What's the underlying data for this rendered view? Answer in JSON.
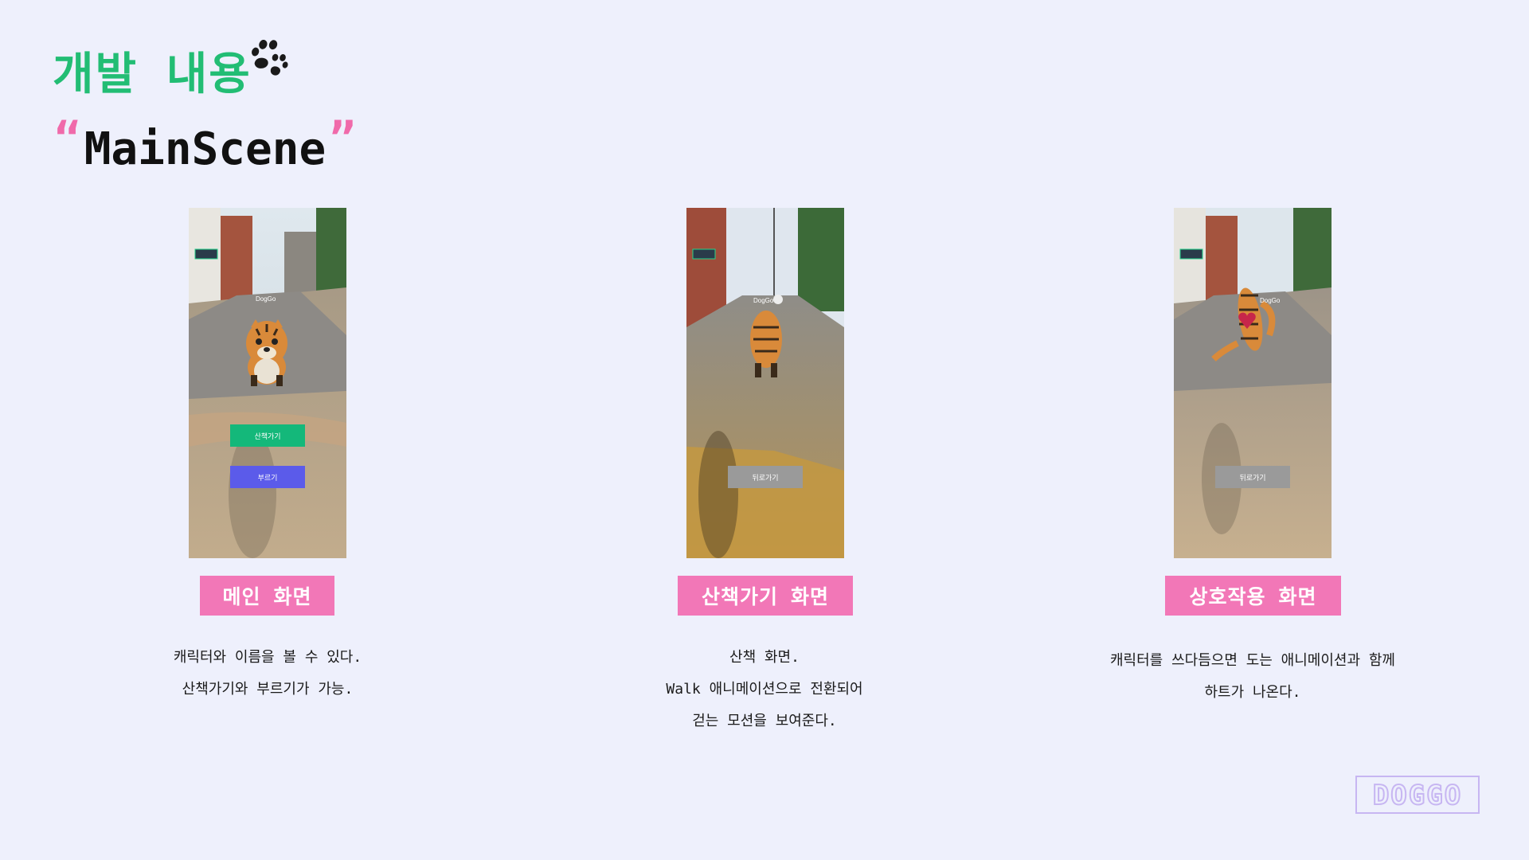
{
  "header": {
    "title": "개발 내용",
    "scene_name": "MainScene",
    "quote_open": "“",
    "quote_close": "”"
  },
  "screens": [
    {
      "caption": "메인 화면",
      "desc_lines": [
        "캐릭터와 이름을 볼 수 있다.",
        "산책가기와 부르기가 가능."
      ],
      "app_name": "DogGo",
      "buttons": [
        {
          "label": "산책가기",
          "color": "#14b87a"
        },
        {
          "label": "부르기",
          "color": "#5b5bea"
        }
      ]
    },
    {
      "caption": "산책가기 화면",
      "desc_lines": [
        "산책 화면.",
        "Walk 애니메이션으로 전환되어",
        "걷는 모션을 보여준다."
      ],
      "app_name": "DogGo",
      "buttons": [
        {
          "label": "뒤로가기",
          "color": "#9a9a9a"
        }
      ]
    },
    {
      "caption": "상호작용 화면",
      "desc_lines": [
        "캐릭터를 쓰다듬으면 도는 애니메이션과 함께",
        "하트가 나온다."
      ],
      "app_name": "DogGo",
      "buttons": [
        {
          "label": "뒤로가기",
          "color": "#9a9a9a"
        }
      ]
    }
  ],
  "icons": {
    "paw": "paw-icon",
    "logo": "DOGGO"
  },
  "colors": {
    "background": "#eef0fc",
    "title_green": "#22bd74",
    "badge_pink": "#f277b7",
    "logo_purple": "#c7b6f2"
  }
}
